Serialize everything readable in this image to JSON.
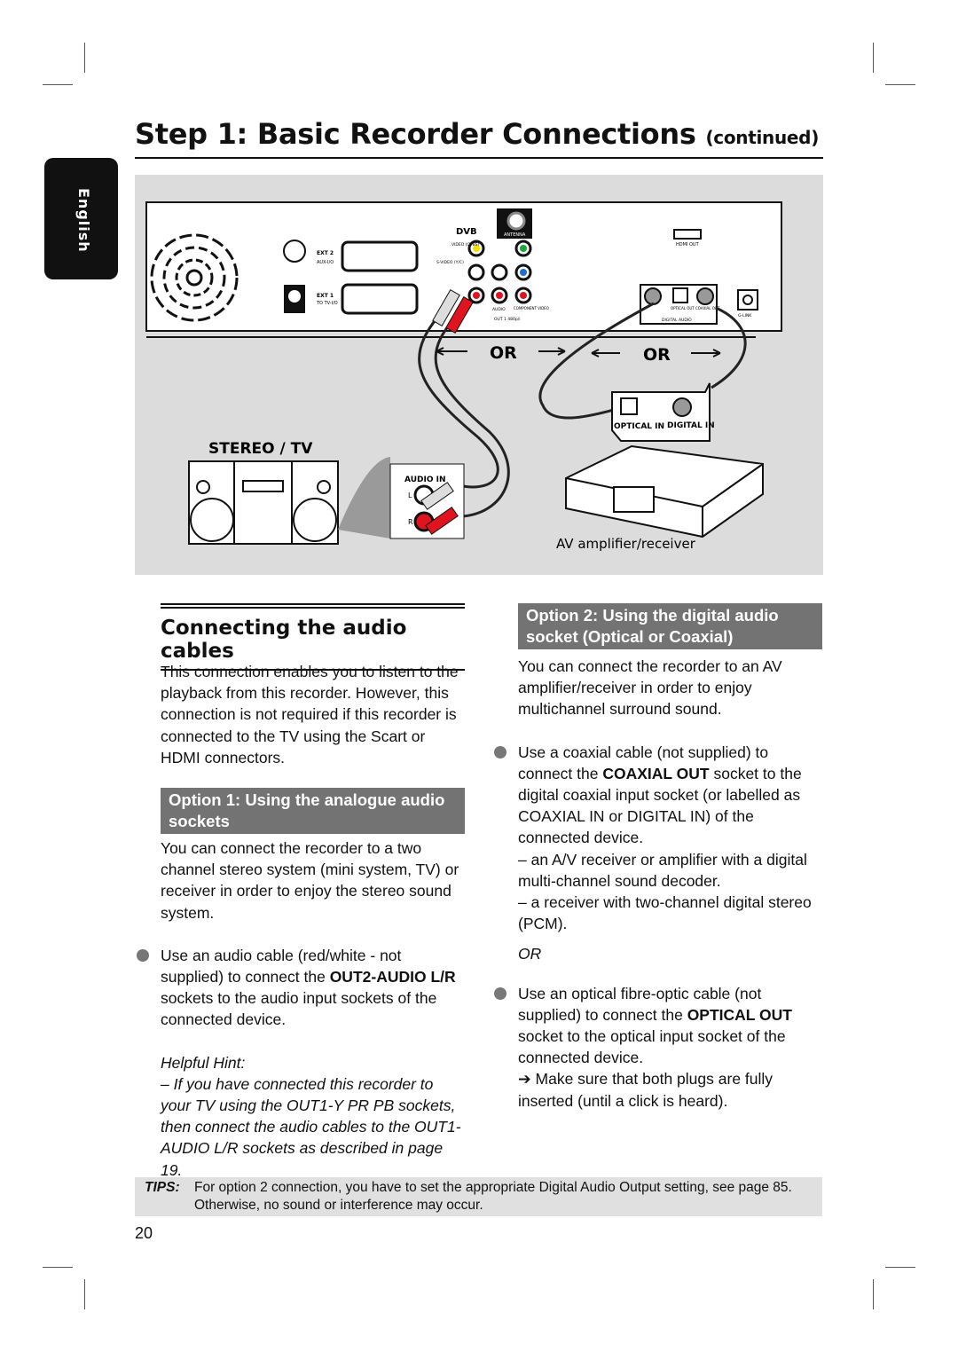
{
  "header": {
    "title": "Step 1: Basic Recorder Connections",
    "title_suffix": "(continued)",
    "language_tab": "English"
  },
  "diagram": {
    "recorder_labels": {
      "ext2": "EXT 2",
      "aux": "AUX-I/O",
      "ext1": "EXT 1",
      "totv": "TO TV-I/O",
      "dvb": "DVB",
      "antenna": "ANTENNA",
      "video": "VIDEO (CVBS)",
      "svideo": "S-VIDEO (Y/C)",
      "audio": "AUDIO",
      "component": "COMPONENT VIDEO",
      "out1": "OUT 1  480p/i",
      "hdmi": "HDMI OUT",
      "optical_out": "OPTICAL OUT",
      "coaxial_out": "COAXIAL OUT",
      "digital_audio": "DIGITAL  AUDIO",
      "glink": "G-LINK"
    },
    "or_left": "OR",
    "or_right": "OR",
    "stereo_label": "STEREO / TV",
    "audio_in": "AUDIO IN",
    "l": "L",
    "r": "R",
    "optical_in": "OPTICAL IN",
    "digital_in": "DIGITAL IN",
    "receiver_label": "AV amplifier/receiver",
    "colors": {
      "red": "#e0141e",
      "yellow": "#f2e200",
      "green": "#1aa83a",
      "blue": "#1c6fd0",
      "bg": "#dcdcdc"
    }
  },
  "left": {
    "heading": "Connecting the audio cables",
    "intro": "This connection enables you to listen to the playback from this recorder. However, this connection is not required if this recorder is connected to the TV using the Scart or HDMI connectors.",
    "option1_title": "Option 1: Using the analogue audio sockets",
    "option1_text": "You can connect the recorder to a two channel stereo system (mini system, TV) or receiver in order to enjoy the stereo sound system.",
    "bullet_pre": "Use an audio cable (red/white - not supplied) to connect the ",
    "bullet_bold": "OUT2-AUDIO L/R",
    "bullet_post": " sockets to the audio input sockets of the connected device.",
    "hint_title": "Helpful Hint:",
    "hint_text": "– If you have connected this recorder to your TV using the OUT1-Y PR PB sockets, then connect the audio cables to the OUT1-AUDIO L/R sockets as described in page 19."
  },
  "right": {
    "option2_title": "Option 2: Using the digital audio socket (Optical or Coaxial)",
    "option2_text": "You can connect the recorder to an AV amplifier/receiver in order to enjoy multichannel surround sound.",
    "b1_pre": "Use a coaxial cable (not supplied) to connect the ",
    "b1_bold": "COAXIAL OUT",
    "b1_post": " socket to the digital coaxial input socket (or labelled as COAXIAL IN or DIGITAL IN) of the connected device.",
    "sub1": "– an A/V receiver or amplifier with a digital multi-channel sound decoder.",
    "sub2": "– a receiver with two-channel digital stereo (PCM).",
    "or": "OR",
    "b2_pre": "Use an optical fibre-optic cable (not supplied) to connect the ",
    "b2_bold": "OPTICAL OUT",
    "b2_post": " socket to the optical input socket of the connected device.",
    "result": "➔ Make sure that both plugs are fully inserted (until a click is heard)."
  },
  "tips": {
    "label": "TIPS:",
    "text": "For option 2 connection, you have to set the appropriate Digital Audio Output setting, see page 85. Otherwise, no sound or interference may occur."
  },
  "page_number": "20"
}
